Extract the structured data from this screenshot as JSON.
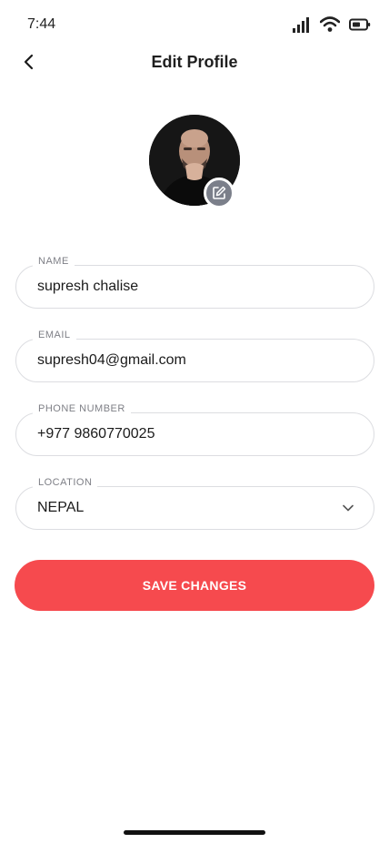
{
  "status_bar": {
    "time": "7:44"
  },
  "header": {
    "title": "Edit Profile"
  },
  "avatar": {
    "alt": "profile photo"
  },
  "form": {
    "name": {
      "label": "NAME",
      "value": "supresh chalise"
    },
    "email": {
      "label": "EMAIL",
      "value": "supresh04@gmail.com"
    },
    "phone": {
      "label": "PHONE NUMBER",
      "value": "+977 9860770025"
    },
    "location": {
      "label": "LOCATION",
      "value": "NEPAL"
    }
  },
  "actions": {
    "save_label": "SAVE CHANGES"
  },
  "colors": {
    "accent": "#f64a4e",
    "edit_badge": "#7b7f8a",
    "border": "#dcdde1"
  },
  "icons": [
    "back-icon",
    "signal-icon",
    "wifi-icon",
    "battery-icon",
    "edit-icon",
    "chevron-down-icon"
  ]
}
